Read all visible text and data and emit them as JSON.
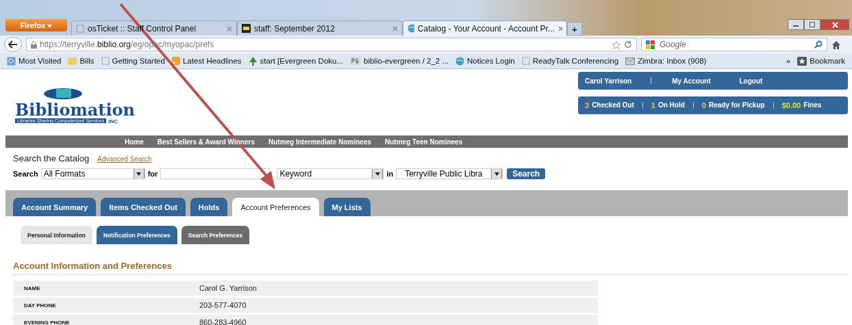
{
  "browser": {
    "menu_button": "Firefox",
    "tabs": [
      {
        "title": "osTicket :: Staff Control Panel",
        "selected": false
      },
      {
        "title": "staff: September 2012",
        "selected": false
      },
      {
        "title": "Catalog - Your Account - Account Pr...",
        "selected": true
      }
    ],
    "new_tab": "+",
    "url": {
      "prefix": "https://terryville.",
      "host": "biblio.org",
      "path": "/eg/opac/myopac/prefs"
    },
    "search_placeholder": "Google",
    "bookmarks": [
      {
        "label": "Most Visited"
      },
      {
        "label": "Bills"
      },
      {
        "label": "Getting Started"
      },
      {
        "label": "Latest Headlines"
      },
      {
        "label": "start [Evergreen Doku..."
      },
      {
        "label": "biblio-evergreen / 2_2 ..."
      },
      {
        "label": "Notices Login"
      },
      {
        "label": "ReadyTalk Conferencing"
      },
      {
        "label": "Zimbra: Inbox (908)"
      }
    ],
    "more": "»",
    "bookmarks_menu": "Bookmark"
  },
  "page": {
    "logo": {
      "name": "Bibliomation",
      "tagline": "Libraries Sharing Computerized Services",
      "suffix": "INC"
    },
    "user_links": [
      "Carol Yarrison",
      "My Account",
      "Logout"
    ],
    "stats": [
      {
        "count": "3",
        "label": "Checked Out",
        "color": "#f0c24a"
      },
      {
        "count": "1",
        "label": "On Hold",
        "color": "#f0c24a"
      },
      {
        "count": "0",
        "label": "Ready for Pickup",
        "color": "#f0c24a"
      },
      {
        "count": "$0.00",
        "label": "Fines",
        "color": "#d6ea1e"
      }
    ],
    "nav": [
      "Home",
      "Best Sellers & Award Winners",
      "Nutmeg Intermediate Nominees",
      "Nutmeg Teen Nominees"
    ],
    "search": {
      "title": "Search the Catalog",
      "advanced": "Advanced Search",
      "label": "Search",
      "format": "All Formats",
      "for": "for",
      "type": "Keyword",
      "in": "in",
      "library": "Terryville Public Libra",
      "button": "Search"
    },
    "account_tabs": [
      {
        "label": "Account Summary",
        "selected": false
      },
      {
        "label": "Items Checked Out",
        "selected": false
      },
      {
        "label": "Holds",
        "selected": false
      },
      {
        "label": "Account Preferences",
        "selected": true
      },
      {
        "label": "My Lists",
        "selected": false
      }
    ],
    "sub_tabs": [
      {
        "label": "Personal Information",
        "selected": true,
        "color": "#e6e6e6"
      },
      {
        "label": "Notification Preferences",
        "selected": false,
        "color": "#336699"
      },
      {
        "label": "Search Preferences",
        "selected": false,
        "color": "#6b6b6b"
      }
    ],
    "heading": "Account Information and Preferences",
    "rows": [
      {
        "label": "NAME",
        "value": "Carol G. Yarrison"
      },
      {
        "label": "DAY PHONE",
        "value": "203-577-4070"
      },
      {
        "label": "EVENING PHONE",
        "value": "860-283-4960"
      }
    ]
  }
}
